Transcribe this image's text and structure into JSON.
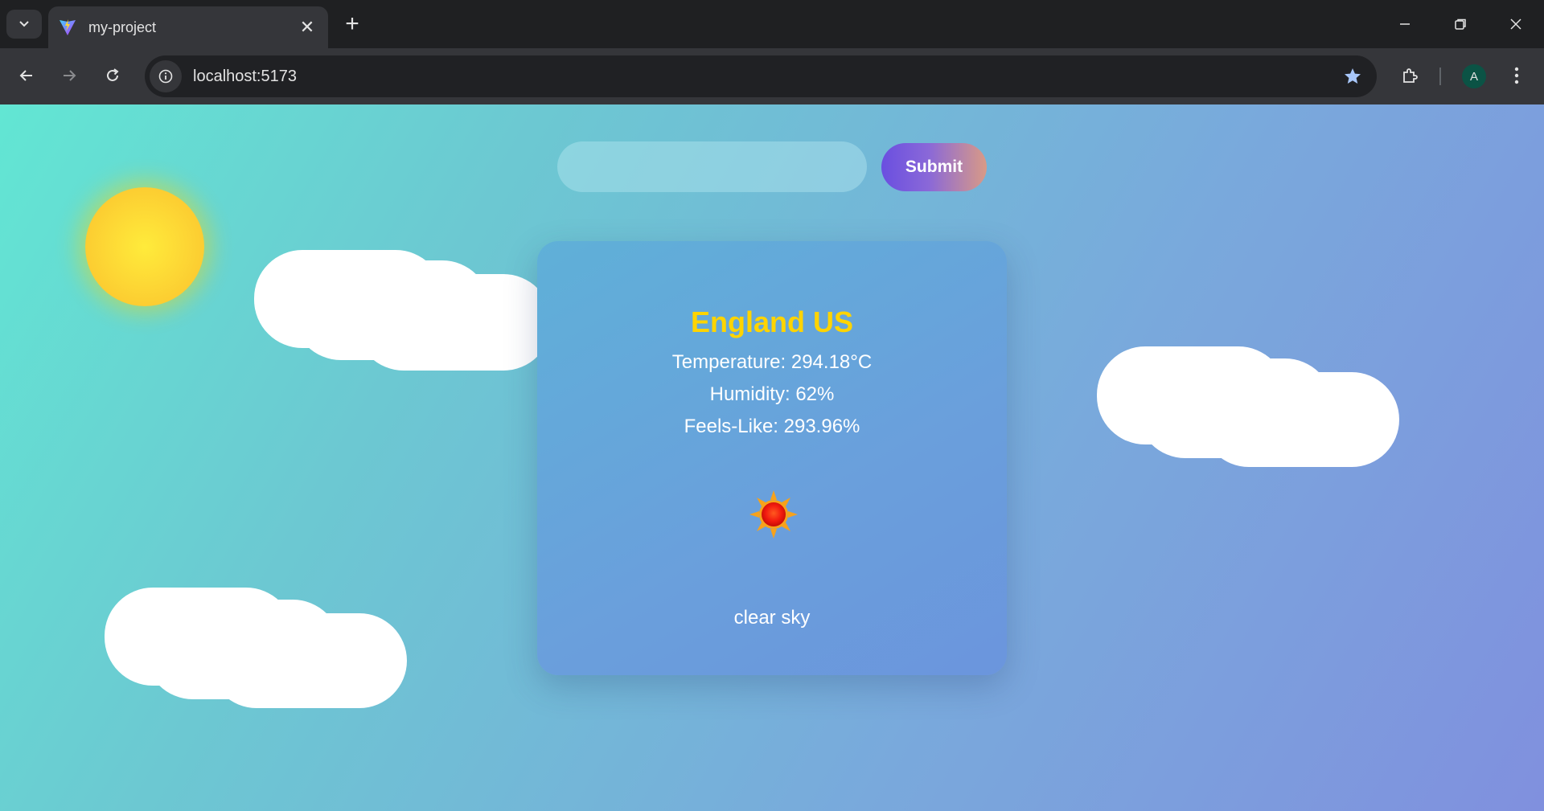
{
  "browser": {
    "tab_title": "my-project",
    "url": "localhost:5173",
    "profile_initial": "A"
  },
  "app": {
    "search": {
      "placeholder": "",
      "value": ""
    },
    "submit_label": "Submit",
    "weather": {
      "city": "England US",
      "temperature": "Temperature: 294.18°C",
      "humidity": "Humidity: 62%",
      "feels_like": "Feels-Like: 293.96%",
      "description": "clear sky",
      "icon": "sun-icon"
    }
  },
  "colors": {
    "city_title": "#ffd400",
    "card_bg": "#65a6da",
    "submit_gradient_start": "#6a4fe0",
    "submit_gradient_end": "#d99a86"
  }
}
